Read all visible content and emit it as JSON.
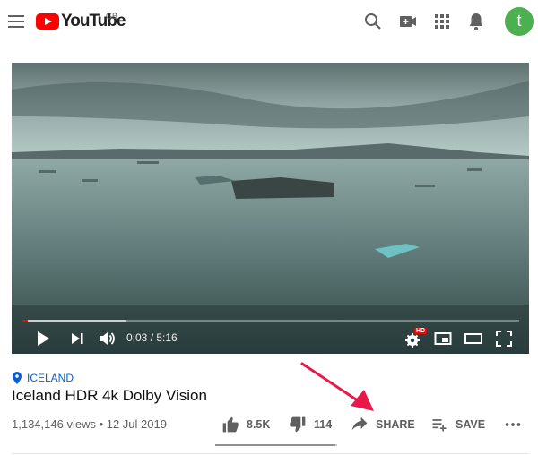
{
  "header": {
    "logo_text": "YouTube",
    "region": "GB",
    "avatar_letter": "t",
    "icons": [
      "menu-icon",
      "search-icon",
      "create-video-icon",
      "apps-icon",
      "notifications-icon"
    ]
  },
  "player": {
    "time_display": "0:03 / 5:16",
    "hd_badge": "HD",
    "progress_played": 0.01,
    "progress_buffered": 0.21
  },
  "video": {
    "tag": "ICELAND",
    "title": "Iceland HDR 4k Dolby Vision",
    "views": "1,134,146 views",
    "date": "12 Jul 2019",
    "meta_separator": " • "
  },
  "actions": {
    "like_count": "8.5K",
    "dislike_count": "114",
    "share_label": "SHARE",
    "save_label": "SAVE",
    "like_ratio": 0.987
  },
  "colors": {
    "brand_red": "#ff0000",
    "link_blue": "#065fd4",
    "avatar_green": "#4caf50",
    "annotation_arrow": "#e8194a"
  }
}
